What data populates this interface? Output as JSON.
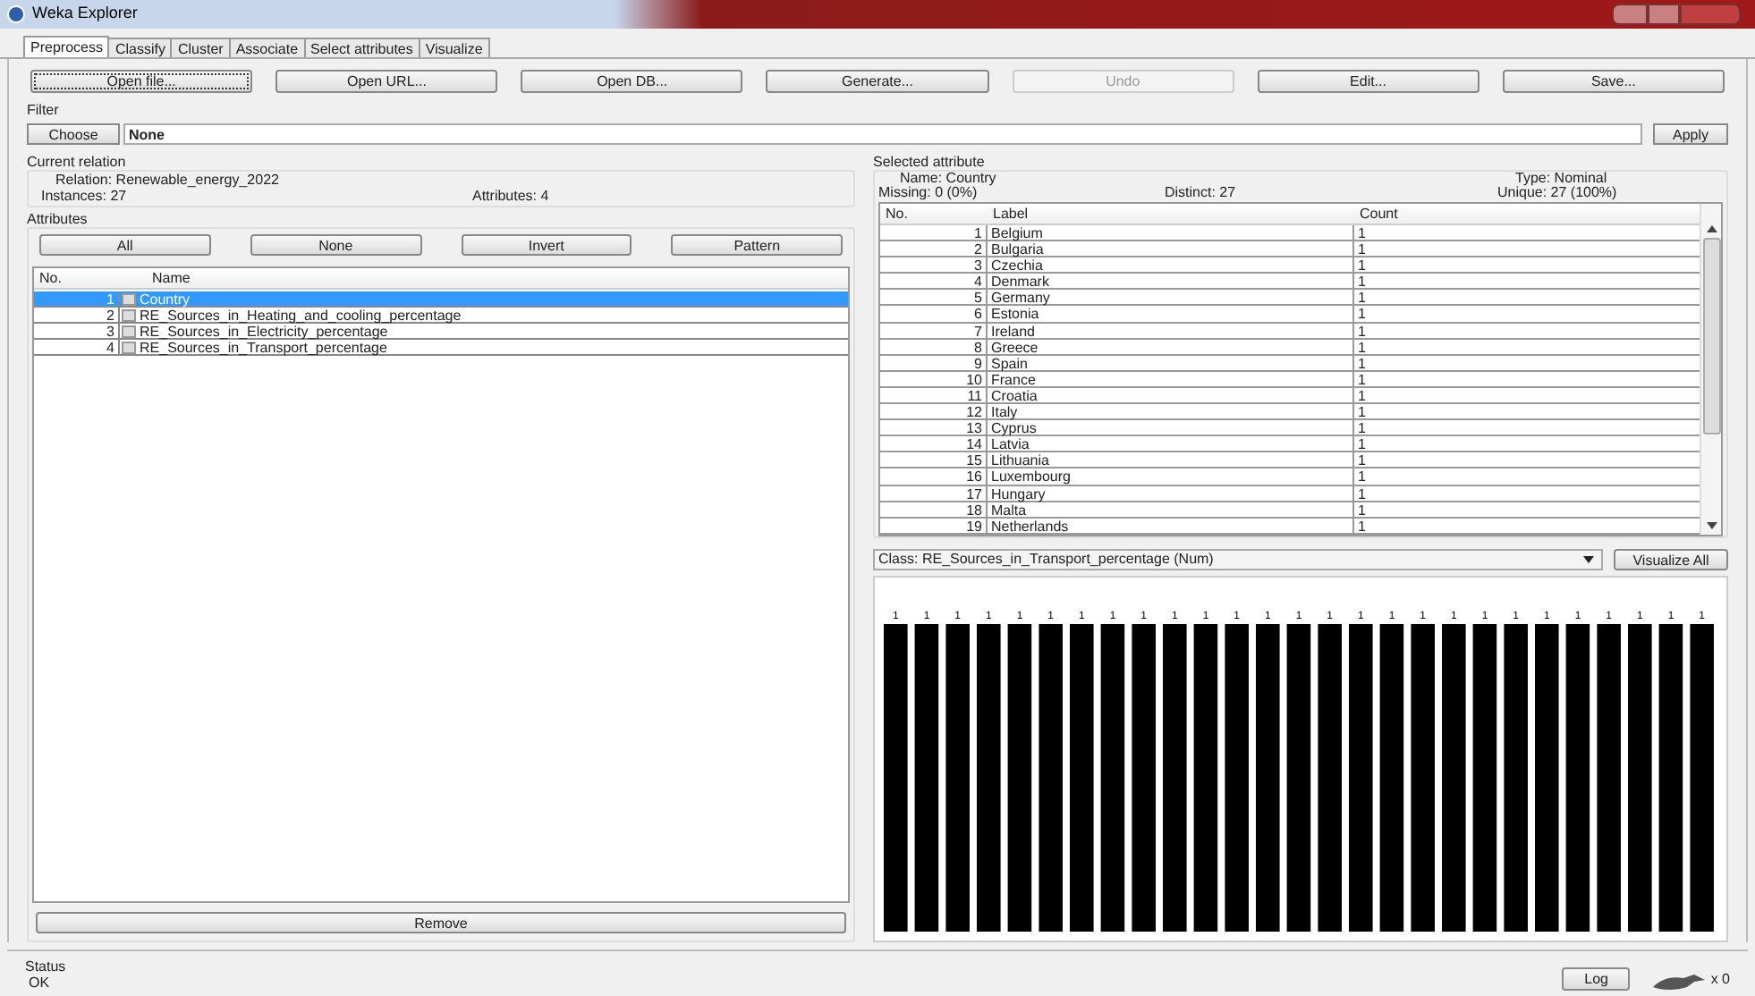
{
  "window": {
    "title": "Weka Explorer"
  },
  "tabs": [
    {
      "label": "Preprocess",
      "selected": true
    },
    {
      "label": "Classify",
      "selected": false
    },
    {
      "label": "Cluster",
      "selected": false
    },
    {
      "label": "Associate",
      "selected": false
    },
    {
      "label": "Select attributes",
      "selected": false
    },
    {
      "label": "Visualize",
      "selected": false
    }
  ],
  "toolbar_buttons": [
    {
      "label": "Open file...",
      "disabled": false
    },
    {
      "label": "Open URL...",
      "disabled": false
    },
    {
      "label": "Open DB...",
      "disabled": false
    },
    {
      "label": "Generate...",
      "disabled": false
    },
    {
      "label": "Undo",
      "disabled": true
    },
    {
      "label": "Edit...",
      "disabled": false
    },
    {
      "label": "Save...",
      "disabled": false
    }
  ],
  "filter": {
    "title": "Filter",
    "choose_button": "Choose",
    "value": "None",
    "apply_button": "Apply"
  },
  "current_relation": {
    "title": "Current relation",
    "relation": "Relation: Renewable_energy_2022",
    "instances": "Instances: 27",
    "attributes": "Attributes: 4"
  },
  "attributes": {
    "title": "Attributes",
    "buttons": [
      "All",
      "None",
      "Invert",
      "Pattern"
    ],
    "columns": [
      "No.",
      "Name"
    ],
    "rows": [
      {
        "no": "1",
        "name": "Country",
        "checked": false,
        "selected": true
      },
      {
        "no": "2",
        "name": "RE_Sources_in_Heating_and_cooling_percentage",
        "checked": false,
        "selected": false
      },
      {
        "no": "3",
        "name": "RE_Sources_in_Electricity_percentage",
        "checked": false,
        "selected": false
      },
      {
        "no": "4",
        "name": "RE_Sources_in_Transport_percentage",
        "checked": false,
        "selected": false
      }
    ],
    "remove_button": "Remove"
  },
  "selected_attribute": {
    "title": "Selected attribute",
    "name": "Name: Country",
    "missing": "Missing: 0 (0%)",
    "distinct": "Distinct: 27",
    "type": "Type: Nominal",
    "unique": "Unique: 27 (100%)",
    "columns": [
      "No.",
      "Label",
      "Count"
    ],
    "rows": [
      {
        "no": "1",
        "label": "Belgium",
        "count": "1"
      },
      {
        "no": "2",
        "label": "Bulgaria",
        "count": "1"
      },
      {
        "no": "3",
        "label": "Czechia",
        "count": "1"
      },
      {
        "no": "4",
        "label": "Denmark",
        "count": "1"
      },
      {
        "no": "5",
        "label": "Germany",
        "count": "1"
      },
      {
        "no": "6",
        "label": "Estonia",
        "count": "1"
      },
      {
        "no": "7",
        "label": "Ireland",
        "count": "1"
      },
      {
        "no": "8",
        "label": "Greece",
        "count": "1"
      },
      {
        "no": "9",
        "label": "Spain",
        "count": "1"
      },
      {
        "no": "10",
        "label": "France",
        "count": "1"
      },
      {
        "no": "11",
        "label": "Croatia",
        "count": "1"
      },
      {
        "no": "12",
        "label": "Italy",
        "count": "1"
      },
      {
        "no": "13",
        "label": "Cyprus",
        "count": "1"
      },
      {
        "no": "14",
        "label": "Latvia",
        "count": "1"
      },
      {
        "no": "15",
        "label": "Lithuania",
        "count": "1"
      },
      {
        "no": "16",
        "label": "Luxembourg",
        "count": "1"
      },
      {
        "no": "17",
        "label": "Hungary",
        "count": "1"
      },
      {
        "no": "18",
        "label": "Malta",
        "count": "1"
      },
      {
        "no": "19",
        "label": "Netherlands",
        "count": "1"
      }
    ]
  },
  "class_selector": {
    "value": "Class: RE_Sources_in_Transport_percentage (Num)"
  },
  "visualize_all_button": "Visualize All",
  "histogram": {
    "bar_labels": [
      "1",
      "1",
      "1",
      "1",
      "1",
      "1",
      "1",
      "1",
      "1",
      "1",
      "1",
      "1",
      "1",
      "1",
      "1",
      "1",
      "1",
      "1",
      "1",
      "1",
      "1",
      "1",
      "1",
      "1",
      "1",
      "1",
      "1"
    ]
  },
  "status": {
    "title": "Status",
    "message": "OK",
    "log_button": "Log",
    "task_count": "x 0"
  }
}
